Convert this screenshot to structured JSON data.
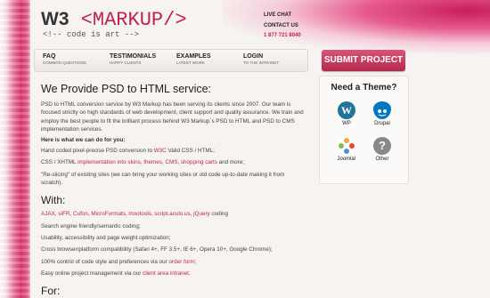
{
  "logo": {
    "brand": "W3",
    "markup": "<MARKUP/>",
    "tagline": "<!-- code is art -->"
  },
  "contacts": {
    "live_chat": "LIVE CHAT",
    "contact_us": "CONTACT US",
    "phone": "1 877 721 8040"
  },
  "nav": [
    {
      "title": "FAQ",
      "subtitle": "COMMON QUESTIONS"
    },
    {
      "title": "TESTIMONIALS",
      "subtitle": "HAPPY CLIENTS"
    },
    {
      "title": "EXAMPLES",
      "subtitle": "LATEST WORK"
    },
    {
      "title": "LOGIN",
      "subtitle": "TO THE INTRANET"
    }
  ],
  "submit_label": "SUBMIT PROJECT",
  "main": {
    "heading": "We Provide PSD to HTML service:",
    "intro": "PSD to HTML conversion service by W3 Markup has been serving its clients since 2007. Our team is focused strictly on high standards of web development, client support and quality assurance. We train and employ the best people to fit the brilliant process behind W3 Markup`s PSD to HTML and PSD to CMS implementation services.",
    "here_heading": "Here is what we can do for you:",
    "item1_prefix": "Hand coded pixel-precise PSD conversion to ",
    "item1_link": "W3C",
    "item1_suffix": " Valid CSS / HTML;",
    "item2_prefix": "CSS / XHTML ",
    "item2_link": "implementation into skins, themes, CMS, shopping carts",
    "item2_suffix": " and more;",
    "item3": "\"Re-slicing\" of existing sites (we can bring your working sites or old code up-to-date making it from scratch).",
    "with_heading": "With:",
    "tech_links": [
      "AJAX",
      "sIFR",
      "Cufon",
      "MicroFormats",
      "mootools",
      "script.aculo.us",
      "jQuery"
    ],
    "tech_suffix": " coding",
    "with1": "Search engine friendly/semantic coding;",
    "with2": "Usability, accessibility and page weight optimization;",
    "with3": "Cross browser/platform compatibility (Safari 4+, FF 3.5+, IE 6+, Opera 10+, Google Chrome);",
    "with4_prefix": "100% control of code style and preferences via our ",
    "with4_link": "order form",
    "with4_suffix": ";",
    "with5_prefix": "Easy online project management via our ",
    "with5_link": "client area intranet",
    "with5_suffix": ".",
    "for_heading": "For:"
  },
  "theme_panel": {
    "title": "Need a Theme?",
    "items": [
      {
        "label": "WP",
        "icon": "wordpress-icon"
      },
      {
        "label": "Drupal",
        "icon": "drupal-icon"
      },
      {
        "label": "Joomla!",
        "icon": "joomla-icon"
      },
      {
        "label": "Other",
        "icon": "question-icon"
      }
    ]
  },
  "colors": {
    "accent": "#c0244e",
    "button": "#c23a5d",
    "text": "#333333"
  }
}
